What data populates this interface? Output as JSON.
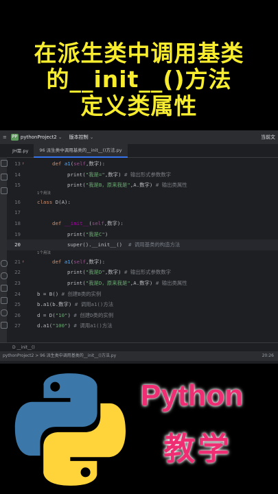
{
  "headline": {
    "line1": "在派生类中调用基类",
    "line2": "的__init__()方法",
    "line3": "定义类属性"
  },
  "ide": {
    "project_badge": "PP",
    "project_name": "pythonProject2",
    "vcs_label": "版本控制",
    "right_label": "当前文",
    "tabs": [
      "JH需.py",
      "96 派生类中调用基类的__init__()方法.py"
    ],
    "usage_hint": "1个用法",
    "breadcrumb": "D    __init__()",
    "status_path": "pythonProject2 > 96 派生类中调用基类的__init__()方法.py",
    "status_pos": "20:26"
  },
  "code_lines": [
    {
      "n": "13",
      "mark": "↑",
      "tokens": [
        [
          "kw",
          "def "
        ],
        [
          "fn",
          "a1"
        ],
        [
          "py",
          "("
        ],
        [
          "sl",
          "self"
        ],
        [
          "py",
          ",数字):"
        ]
      ],
      "indent": 2
    },
    {
      "n": "14",
      "tokens": [
        [
          "py",
          "print("
        ],
        [
          "st",
          "\"我是=\""
        ],
        [
          "py",
          ",数字)"
        ],
        [
          "cm",
          " # 输出形式参数数字"
        ]
      ],
      "indent": 4
    },
    {
      "n": "15",
      "tokens": [
        [
          "py",
          "print("
        ],
        [
          "st",
          "\"我是B，原来我是\""
        ],
        [
          "py",
          ",A.数字)"
        ],
        [
          "cm",
          " # 输出类属性"
        ]
      ],
      "indent": 4
    },
    {
      "small": true,
      "text": "1个用法"
    },
    {
      "n": "16",
      "tokens": [
        [
          "kw",
          "class "
        ],
        [
          "py",
          "D(A):"
        ]
      ],
      "indent": 0
    },
    {
      "n": "17",
      "tokens": [],
      "indent": 0
    },
    {
      "n": "18",
      "tokens": [
        [
          "kw",
          "def "
        ],
        [
          "dec",
          "__init__"
        ],
        [
          "py",
          "("
        ],
        [
          "sl",
          "self"
        ],
        [
          "py",
          ",数字):"
        ]
      ],
      "indent": 2
    },
    {
      "n": "19",
      "tokens": [
        [
          "py",
          "print("
        ],
        [
          "st",
          "\"我是C\""
        ],
        [
          "py",
          ")"
        ]
      ],
      "indent": 4
    },
    {
      "n": "20",
      "cur": true,
      "tokens": [
        [
          "py",
          "super().__init__("
        ],
        [
          "py",
          ")"
        ],
        [
          "cm",
          "  # 调用基类的构造方法"
        ]
      ],
      "indent": 4
    },
    {
      "small": true,
      "text": "1个用法"
    },
    {
      "n": "21",
      "mark": "↑",
      "tokens": [
        [
          "kw",
          "def "
        ],
        [
          "fn",
          "a1"
        ],
        [
          "py",
          "("
        ],
        [
          "sl",
          "self"
        ],
        [
          "py",
          ",数字):"
        ]
      ],
      "indent": 2
    },
    {
      "n": "22",
      "tokens": [
        [
          "py",
          "print("
        ],
        [
          "st",
          "\"我是D\""
        ],
        [
          "py",
          ",数字)"
        ],
        [
          "cm",
          " # 输出形式参数数字"
        ]
      ],
      "indent": 4
    },
    {
      "n": "23",
      "tokens": [
        [
          "py",
          "print("
        ],
        [
          "st",
          "\"我是D，原来我是\""
        ],
        [
          "py",
          ",A.数字)"
        ],
        [
          "cm",
          " # 输出类属性"
        ]
      ],
      "indent": 4
    },
    {
      "n": "24",
      "tokens": [
        [
          "py",
          "b = B()"
        ],
        [
          "cm",
          " # 创建B类的实例"
        ]
      ],
      "indent": 0
    },
    {
      "n": "25",
      "tokens": [
        [
          "py",
          "b.a1(b.数字)"
        ],
        [
          "cm",
          " # 调用a1()方法"
        ]
      ],
      "indent": 0
    },
    {
      "n": "26",
      "tokens": [
        [
          "py",
          "d = D("
        ],
        [
          "st",
          "\"10\""
        ],
        [
          "py",
          ")"
        ],
        [
          "cm",
          " # 创建D类的实例"
        ]
      ],
      "indent": 0
    },
    {
      "n": "27",
      "tokens": [
        [
          "py",
          "d.a1("
        ],
        [
          "st",
          "\"100\""
        ],
        [
          "py",
          ")"
        ],
        [
          "cm",
          " # 调用a1()方法"
        ]
      ],
      "indent": 0
    }
  ],
  "promo": {
    "python_label": "Python",
    "teach_label": "教学",
    "logo": "python-logo-icon",
    "colors": {
      "headline": "#f7ec2e",
      "promo": "#ee2d72",
      "logo_blue": "#3b77a8",
      "logo_yellow": "#ffd43b"
    }
  }
}
